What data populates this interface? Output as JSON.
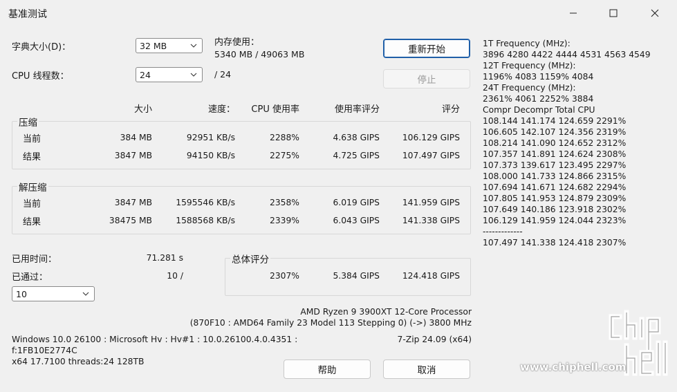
{
  "window": {
    "title": "基准测试"
  },
  "settings": {
    "dict_label": "字典大小(D)：",
    "dict_value": "32 MB",
    "threads_label": "CPU 线程数：",
    "threads_value": "24",
    "threads_max": "/ 24",
    "mem_label": "内存使用：",
    "mem_value": "5340 MB / 49063 MB"
  },
  "buttons": {
    "restart": "重新开始",
    "stop": "停止",
    "help": "帮助",
    "cancel": "取消"
  },
  "headers": {
    "size": "大小",
    "speed": "速度：",
    "cpu": "CPU 使用率",
    "rating_usage": "使用率评分",
    "rating": "评分"
  },
  "compress": {
    "label": "压缩",
    "rows": [
      {
        "label": "当前",
        "size": "384 MB",
        "speed": "92951 KB/s",
        "cpu": "2288%",
        "usage": "4.638 GIPS",
        "rating": "106.129 GIPS"
      },
      {
        "label": "结果",
        "size": "3847 MB",
        "speed": "94150 KB/s",
        "cpu": "2275%",
        "usage": "4.725 GIPS",
        "rating": "107.497 GIPS"
      }
    ]
  },
  "decompress": {
    "label": "解压缩",
    "rows": [
      {
        "label": "当前",
        "size": "3847 MB",
        "speed": "1595546 KB/s",
        "cpu": "2358%",
        "usage": "6.019 GIPS",
        "rating": "141.959 GIPS"
      },
      {
        "label": "结果",
        "size": "38475 MB",
        "speed": "1588568 KB/s",
        "cpu": "2339%",
        "usage": "6.043 GIPS",
        "rating": "141.338 GIPS"
      }
    ]
  },
  "elapsed": {
    "label": "已用时间：",
    "value": "71.281 s"
  },
  "passed": {
    "label": "已通过：",
    "value": "10 /",
    "select": "10"
  },
  "total": {
    "label": "总体评分",
    "cpu": "2307%",
    "usage": "5.384 GIPS",
    "rating": "124.418 GIPS"
  },
  "cpu_info": {
    "name": "AMD Ryzen 9 3900XT 12-Core Processor",
    "detail": "(870F10 : AMD64 Family 23 Model 113 Stepping 0) (->) 3800 MHz"
  },
  "sys_info": {
    "line1": "Windows 10.0 26100 : Microsoft Hv : Hv#1 : 10.0.26100.4.0.4351 :",
    "line2": "f:1FB10E2774C",
    "line3": "x64 17.7100 threads:24 128TB",
    "version": "7-Zip 24.09 (x64)"
  },
  "side_log": [
    "1T Frequency (MHz):",
    " 3896 4280 4422 4444 4531 4563 4549",
    "12T Frequency (MHz):",
    " 1196% 4083 1159% 4084",
    "24T Frequency (MHz):",
    " 2361% 4061 2252% 3884",
    "Compr Decompr Total  CPU",
    "108.144  141.174  124.659  2291%",
    "106.605  142.107  124.356  2319%",
    "108.214  141.090  124.652  2312%",
    "107.357  141.891  124.624  2308%",
    "107.373  139.617  123.495  2297%",
    "108.000  141.733  124.866  2315%",
    "107.694  141.671  124.682  2294%",
    "107.805  141.953  124.879  2309%",
    "107.649  140.186  123.918  2302%",
    "106.129  141.959  124.044  2323%",
    "-------------",
    "107.497  141.338  124.418  2307%"
  ],
  "watermark": {
    "site": "www.chiphell.com",
    "logo": "chip hell"
  }
}
